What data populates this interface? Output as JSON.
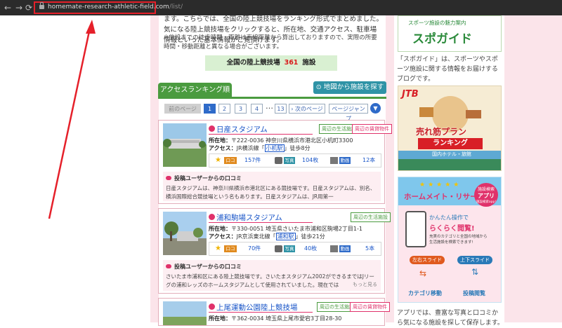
{
  "browser": {
    "url_host": "homemate-research-athletic-field.com",
    "url_path": "/list/",
    "back_icon": "arrow-left-icon",
    "forward_icon": "arrow-right-icon",
    "reload_icon": "reload-icon"
  },
  "intro": {
    "text": "ます。こちらでは、全国の陸上競技場をランキング形式でまとめました。気になる陸上競技場をクリックすると、所在地、交通アクセス、駐車場情報といった基本情報がご覧頂けます。",
    "note": "※施設までの徒歩時間・距離は直線距離から算出しておりますので、実際の所要時間・移動距離と異なる場合がございます。"
  },
  "count": {
    "label": "全国の陸上競技場",
    "value": "361",
    "unit": "施設"
  },
  "tabs": {
    "ranking": "アクセスランキング順",
    "map": "地図から施設を探す"
  },
  "pager": {
    "prev": "前のページ",
    "pages": [
      "1",
      "2",
      "3",
      "4"
    ],
    "dots": "…",
    "last": "13",
    "next": "次のページ",
    "jump": "ページジャンプ"
  },
  "labels": {
    "address": "所在地：",
    "access": "アクセス：",
    "kuchikomi": "口コミ",
    "photo": "写真",
    "video": "動画",
    "review_head": "投稿ユーザーからの口コミ"
  },
  "facilities": [
    {
      "name": "日産スタジアム",
      "tags": [
        "周辺の生活施設",
        "周辺の賃貸物件"
      ],
      "address": "〒222-0036 神奈川県横浜市港北区小机町3300",
      "access_pre": "JR横浜線「",
      "station": "小机駅",
      "access_post": "」徒歩8分",
      "reviews": "157件",
      "photos": "104枚",
      "videos": "12本",
      "review_text": "日産スタジアムは、神奈川県横浜市港北区にある競技場です。日産スタジアムは、別名、横浜国際総合競技場という名もあります。日産スタジアムは、JR用第一"
    },
    {
      "name": "浦和駒場スタジアム",
      "tags": [
        "周辺の生活施設"
      ],
      "address": "〒330-0051 埼玉県さいたま市浦和区駒場2丁目1-1",
      "access_pre": "JR京浜東北線「",
      "station": "浦和駅",
      "access_post": "」徒歩21分",
      "reviews": "70件",
      "photos": "40枚",
      "videos": "5本",
      "review_text": "さいたま市浦和区にある陸上競技場です。さいたまスタジアム2002ができるまではJリーグの浦和レッズのホームスタジアムとして使用されていました。現在では"
    },
    {
      "name": "上尾運動公園陸上競技場",
      "tags": [
        "周辺の生活施設",
        "周辺の賃貸物件"
      ],
      "address": "〒362-0034 埼玉県上尾市愛宕3丁目28-30"
    }
  ],
  "review_more": "もっと見る",
  "sidebar": {
    "spoguide_top": "スポーツ施設の魅力案内",
    "spoguide_logo": "スポガイド",
    "spoguide_caption": "「スポガイド」は、スポーツやスポーツ施設に関する情報をお届けするブログです。",
    "jtb_logo": "JTB",
    "jtb_title1": "売れ筋プラン",
    "jtb_title2": "ランキング",
    "jtb_sub": "国内ホテル・旅館",
    "hs_title": "ホームメイト・リサーチ",
    "hs_badge1": "施設検索",
    "hs_badge2": "アプリ",
    "hs_badge3": "施設検索app!",
    "hs_line1": "かんたん操作で",
    "hs_line2": "らくらく閲覧!",
    "hs_line3": "充実のカテゴリと全国の地域から",
    "hs_line4": "生活施設を検索できます!",
    "hs_left": "左右スライド",
    "hs_up": "上下スライド",
    "hs_cat": "カテゴリ移動",
    "hs_view": "投稿閲覧",
    "bottom_caption": "アプリでは、豊富な写真と口コミから気になる施設を探して保存します。"
  }
}
